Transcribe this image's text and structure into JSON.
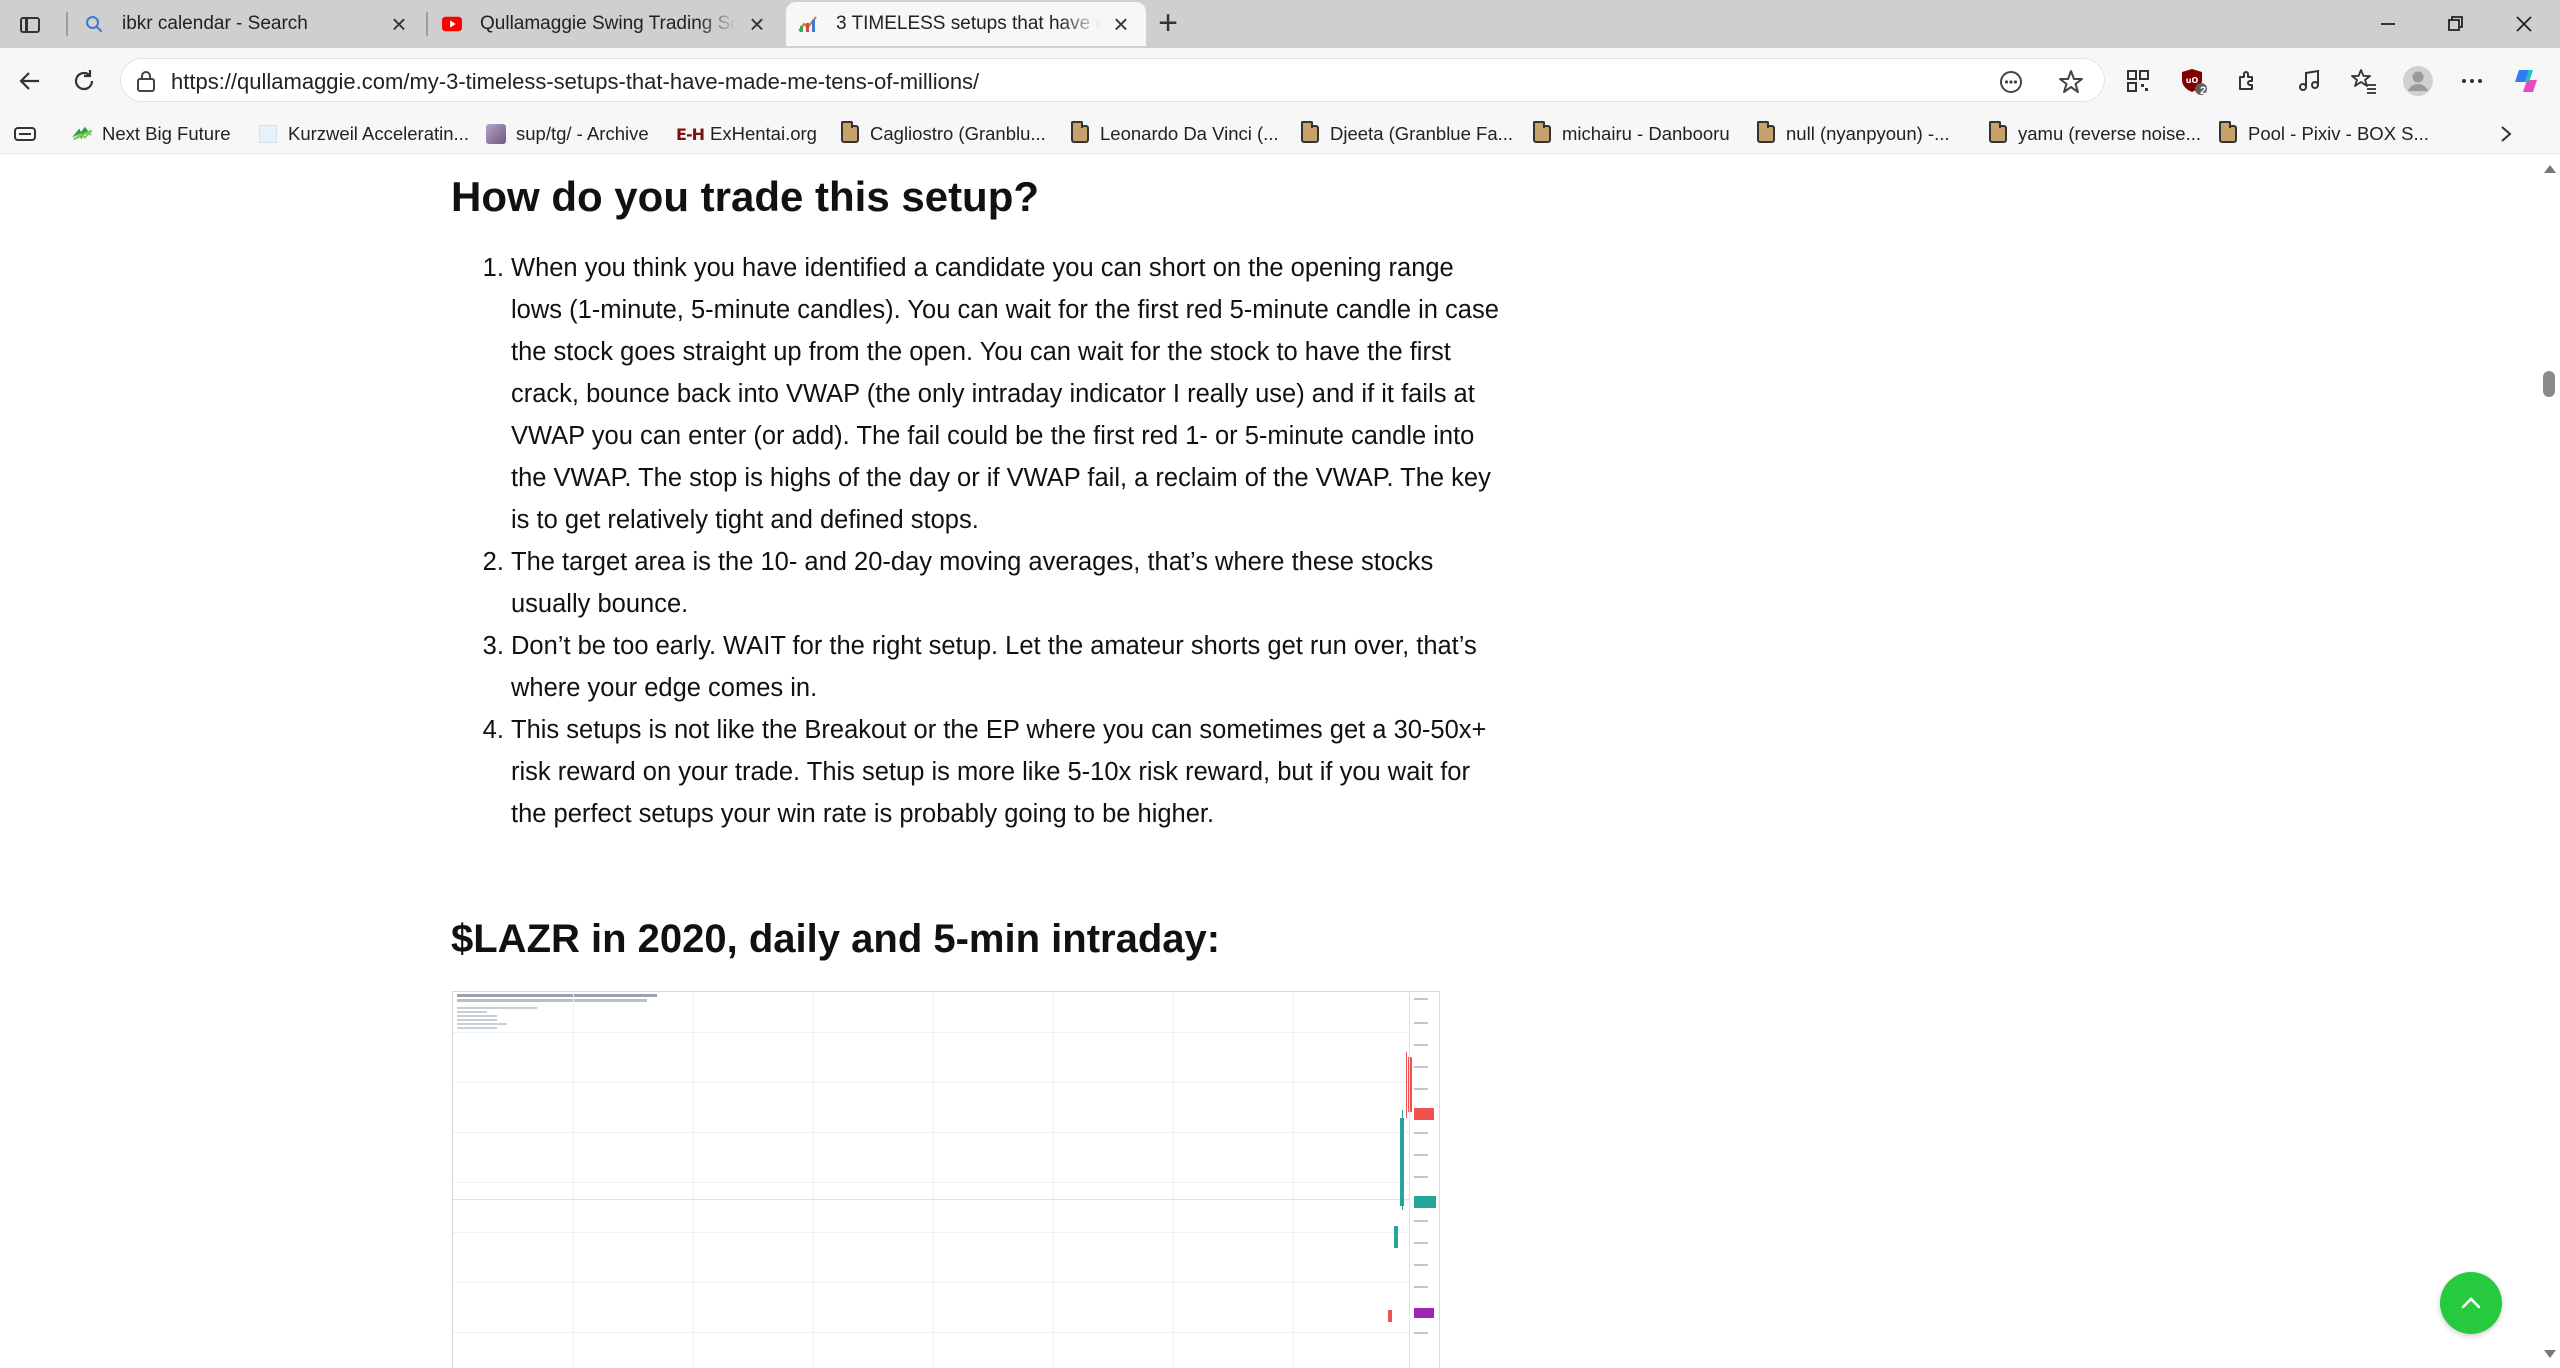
{
  "tabs": [
    {
      "title": "ibkr calendar - Search",
      "icon": "search-icon"
    },
    {
      "title": "Qullamaggie Swing Trading School (",
      "icon": "youtube-icon"
    },
    {
      "title": "3 TIMELESS setups that have made",
      "icon": "site-favicon"
    }
  ],
  "address": {
    "url": "https://qullamaggie.com/my-3-timeless-setups-that-have-made-me-tens-of-millions/"
  },
  "extensions": {
    "ublock_badge": "2"
  },
  "bookmarks": [
    {
      "label": "Next Big Future"
    },
    {
      "label": "Kurzweil Acceleratin..."
    },
    {
      "label": "sup/tg/ - Archive"
    },
    {
      "label": "ExHentai.org",
      "logo": "E-H"
    },
    {
      "label": "Cagliostro (Granblu..."
    },
    {
      "label": "Leonardo Da Vinci (..."
    },
    {
      "label": "Djeeta (Granblue Fa..."
    },
    {
      "label": "michairu - Danbooru"
    },
    {
      "label": "null (nyanpyoun) -..."
    },
    {
      "label": "yamu (reverse noise..."
    },
    {
      "label": "Pool - Pixiv - BOX S..."
    }
  ],
  "article": {
    "heading_trade": "How do you trade this setup?",
    "steps": [
      "When you think you have identified a candidate you can short on the opening range lows (1-minute, 5-minute candles). You can wait for the first red 5-minute candle in case the stock goes straight up from the open. You can wait for the stock to have the first crack, bounce back into VWAP (the only intraday indicator I really use) and if it fails at VWAP you can enter (or add). The fail could be the first red 1- or 5-minute candle into the VWAP. The stop is highs of the day or if VWAP fail, a reclaim of the VWAP. The key is to get relatively tight and defined stops.",
      "The target area is the 10- and 20-day moving averages, that’s where these stocks usually bounce.",
      "Don’t be too early. WAIT for the right setup. Let the amateur shorts get run over, that’s where your edge comes in.",
      "This setups is not like the Breakout or the EP where you can sometimes get a 30-50x+ risk reward on your trade. This setup is more like 5-10x risk reward, but if you wait for the perfect setups your win rate is probably going to be higher."
    ],
    "heading_example": "$LAZR in 2020, daily and 5-min intraday:"
  },
  "colors": {
    "fab": "#27c93f",
    "candle_up": "#26a69a",
    "candle_down": "#ef5350"
  }
}
